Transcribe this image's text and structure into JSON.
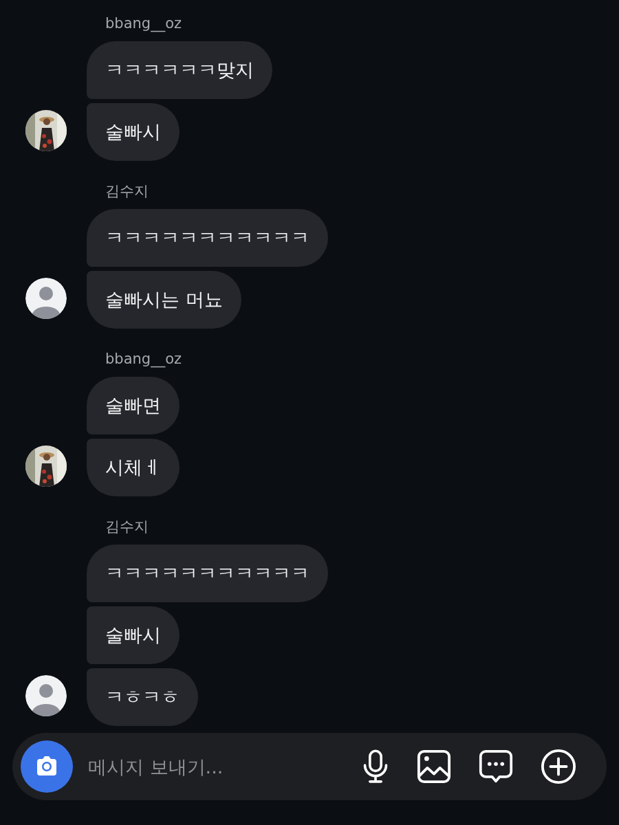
{
  "groups": [
    {
      "sender": "bbang__oz",
      "avatar": {
        "kind": "picture"
      },
      "messages": [
        "ㅋㅋㅋㅋㅋㅋ맞지",
        "술빠시"
      ]
    },
    {
      "sender": "김수지",
      "avatar": {
        "kind": "default"
      },
      "messages": [
        "ㅋㅋㅋㅋㅋㅋㅋㅋㅋㅋㅋ",
        "술빠시는 머뇨"
      ]
    },
    {
      "sender": "bbang__oz",
      "avatar": {
        "kind": "picture"
      },
      "messages": [
        "술빠면",
        "시체ㅔ"
      ]
    },
    {
      "sender": "김수지",
      "avatar": {
        "kind": "default"
      },
      "messages": [
        "ㅋㅋㅋㅋㅋㅋㅋㅋㅋㅋㅋ",
        "술빠시",
        "ㅋㅎㅋㅎ"
      ]
    }
  ],
  "composer": {
    "placeholder": "메시지 보내기..."
  }
}
